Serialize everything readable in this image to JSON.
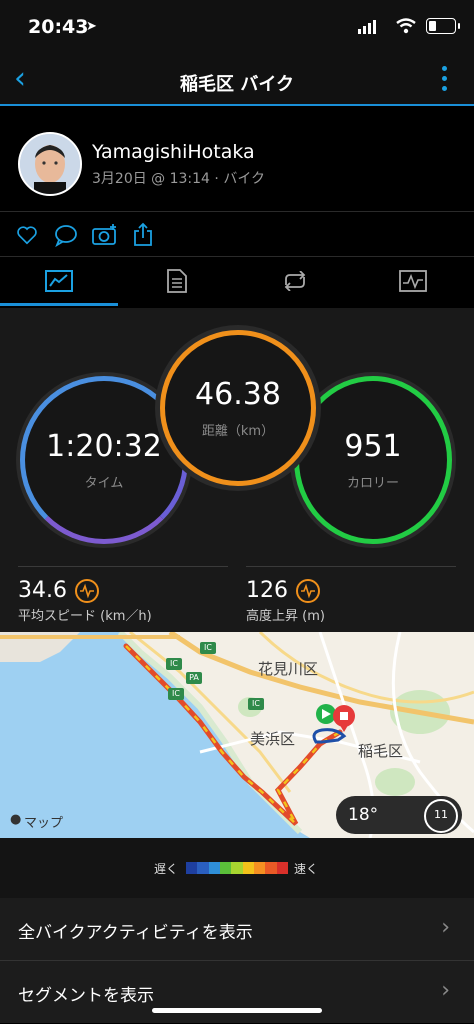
{
  "status_bar": {
    "time": "20:43",
    "location_icon": "location-arrow-icon"
  },
  "nav": {
    "title": "稲毛区 バイク",
    "back_icon": "chevron-left-icon",
    "menu_icon": "more-vertical-icon"
  },
  "profile": {
    "name": "YamagishiHotaka",
    "meta": "3月20日 @ 13:14 · バイク"
  },
  "actions": [
    "heart-icon",
    "comment-icon",
    "camera-add-icon",
    "share-icon"
  ],
  "tabs": [
    "overview-tab-icon",
    "details-tab-icon",
    "laps-tab-icon",
    "charts-tab-icon"
  ],
  "stats": {
    "time": {
      "value": "1:20:32",
      "label": "タイム"
    },
    "distance": {
      "value": "46.38",
      "label": "距離（km）"
    },
    "calories": {
      "value": "951",
      "label": "カロリー"
    },
    "avg_speed": {
      "value": "34.6",
      "label": "平均スピード (km／h)"
    },
    "elevation": {
      "value": "126",
      "label": "高度上昇 (m)"
    }
  },
  "map": {
    "label_hanamigawa": "花見川区",
    "label_mihama": "美浜区",
    "label_inage": "稲毛区",
    "attribution": "マップ",
    "temperature": "18°",
    "wind": "11",
    "ic_labels": [
      "IC",
      "IC",
      "IC",
      "PA",
      "IC"
    ]
  },
  "legend": {
    "slow": "遅く",
    "fast": "速く"
  },
  "list": {
    "all_activities": "全バイクアクティビティを表示",
    "segments": "セグメントを表示"
  },
  "colors": {
    "accent": "#1ba1e2",
    "time_ring": "#4a8fe0",
    "distance_ring": "#f0901b",
    "calorie_ring": "#22cc44"
  }
}
